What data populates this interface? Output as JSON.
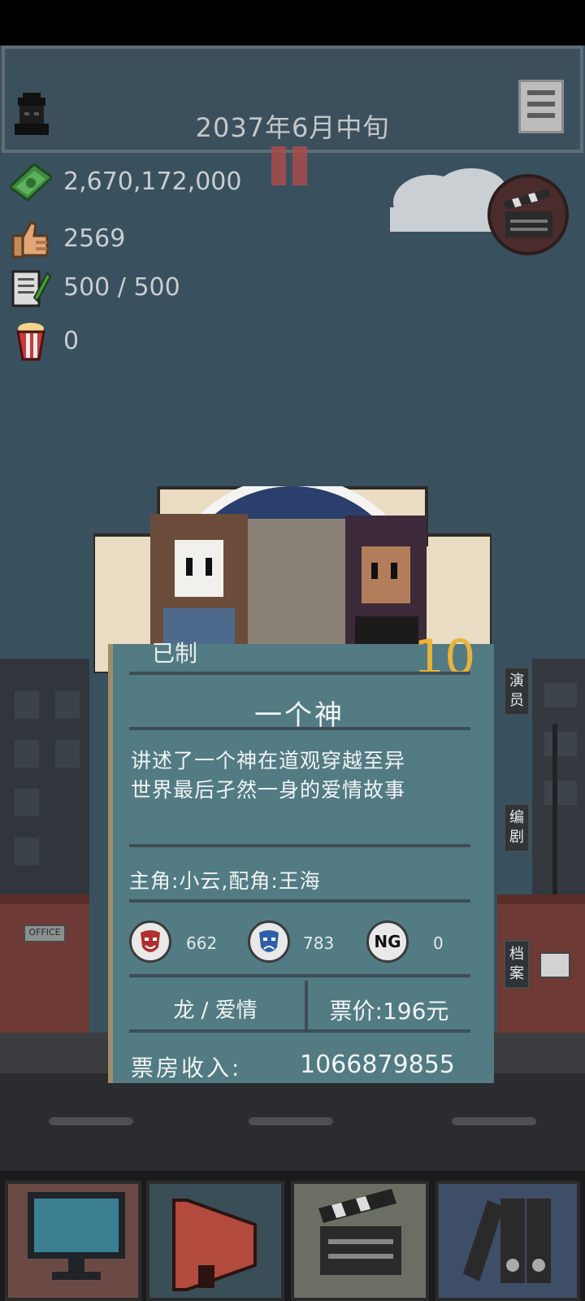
{
  "header": {
    "date": "2037年6月中旬"
  },
  "stats": {
    "money": "2,670,172,000",
    "likes": "2569",
    "scripts": "500 / 500",
    "popcorn": "0"
  },
  "city": {
    "office_sign": "OFFICE"
  },
  "movie": {
    "studio_label": "已制",
    "corner_number": "10",
    "title": "一个神",
    "description_line1": "讲述了一个神在道观穿越至异",
    "description_line2": "世界最后孑然一身的爱情故事",
    "cast": "主角:小云,配角:王海",
    "ratings": {
      "comedy": "662",
      "tragedy": "783",
      "ng": "0",
      "ng_label": "NG"
    },
    "genre": "龙 / 爱情",
    "ticket_price": "票价:196元",
    "box_office_label": "票房收入:",
    "box_office_value": "1066879855"
  },
  "side_tabs": {
    "actors": "演员",
    "writers": "编剧",
    "archive": "档案"
  },
  "colors": {
    "money": "#3f8c3f",
    "accent": "#e7b33b",
    "tragedy_mask": "#2e5fa8",
    "comedy_mask": "#b03030"
  }
}
